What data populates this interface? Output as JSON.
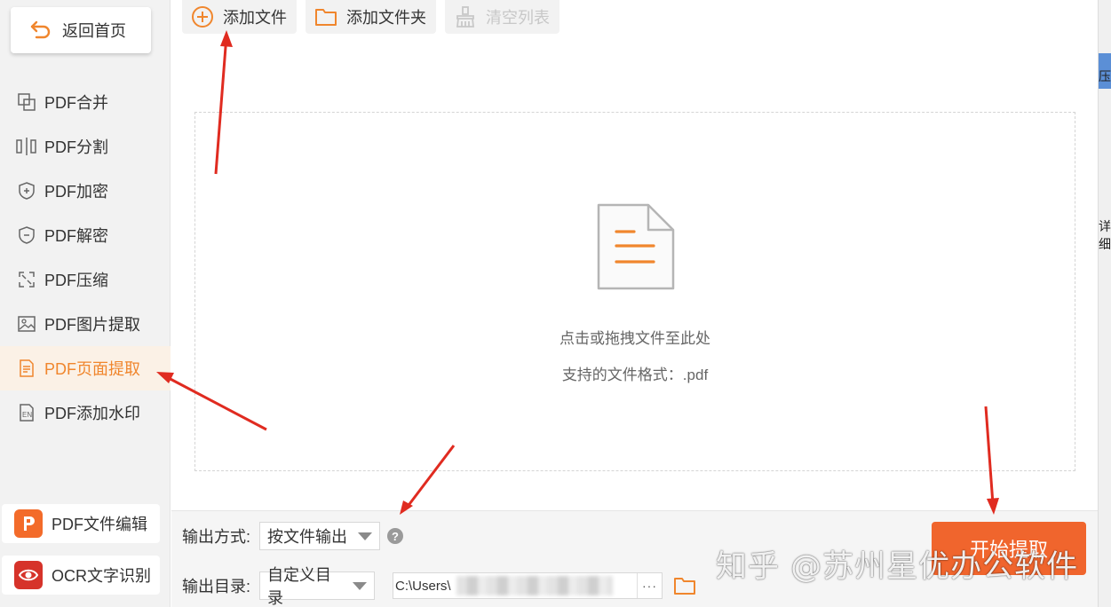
{
  "sidebar": {
    "back_label": "返回首页",
    "items": [
      {
        "label": "PDF合并",
        "icon": "merge-icon"
      },
      {
        "label": "PDF分割",
        "icon": "split-icon"
      },
      {
        "label": "PDF加密",
        "icon": "shield-plus-icon"
      },
      {
        "label": "PDF解密",
        "icon": "shield-minus-icon"
      },
      {
        "label": "PDF压缩",
        "icon": "compress-icon"
      },
      {
        "label": "PDF图片提取",
        "icon": "image-icon"
      },
      {
        "label": "PDF页面提取",
        "icon": "page-icon",
        "active": true
      },
      {
        "label": "PDF添加水印",
        "icon": "watermark-icon"
      }
    ],
    "cards": [
      {
        "label": "PDF文件编辑",
        "icon": "pdf-editor-logo-icon"
      },
      {
        "label": "OCR文字识别",
        "icon": "ocr-eye-logo-icon"
      }
    ]
  },
  "toolbar": {
    "add_file": "添加文件",
    "add_folder": "添加文件夹",
    "clear_list": "清空列表"
  },
  "dropzone": {
    "hint": "点击或拖拽文件至此处",
    "formats": "支持的文件格式：.pdf"
  },
  "output": {
    "mode_label": "输出方式:",
    "mode_value": "按文件输出",
    "dir_label": "输出目录:",
    "dir_value": "自定义目录",
    "path_value": "C:\\Users\\",
    "browse": "···"
  },
  "start_button": "开始提取",
  "watermark": "知乎 @苏州星优办公软件",
  "right_strip": {
    "text1": "压",
    "text2": "详细"
  },
  "colors": {
    "accent": "#f0862d",
    "start": "#f0652d",
    "arrow": "#e02b20"
  }
}
